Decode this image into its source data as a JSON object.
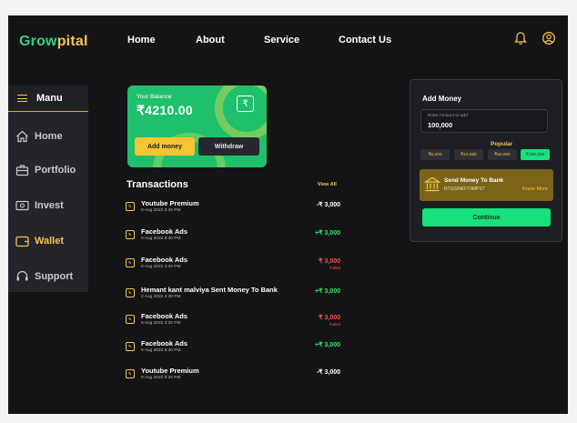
{
  "brand": {
    "part1": "Grow",
    "part2": "pital"
  },
  "nav": [
    "Home",
    "About",
    "Service",
    "Contact Us"
  ],
  "sidebar": {
    "title": "Manu",
    "items": [
      {
        "label": "Home",
        "icon": "home-icon"
      },
      {
        "label": "Portfolio",
        "icon": "briefcase-icon"
      },
      {
        "label": "Invest",
        "icon": "cash-icon"
      },
      {
        "label": "Wallet",
        "icon": "wallet-icon",
        "active": true
      },
      {
        "label": "Support",
        "icon": "headset-icon"
      }
    ]
  },
  "balance": {
    "label": "Your Balance",
    "amount": "₹4210.00",
    "wallet_symbol": "₹",
    "add_label": "Add money",
    "withdraw_label": "Withdraw"
  },
  "transactions": {
    "title": "Transactions",
    "view_all": "View All",
    "items": [
      {
        "name": "Youtube Premium",
        "date": "9 Aug 2022 8:30 PM",
        "amount": "-₹ 3,000",
        "status": "debit"
      },
      {
        "name": "Facebook Ads",
        "date": "9 Aug 2022 8:30 PM",
        "amount": "+₹ 3,000",
        "status": "credit"
      },
      {
        "name": "Facebook Ads",
        "date": "6 Aug 2022 3:30 PM",
        "amount": "₹ 3,000",
        "status": "failed",
        "failed_label": "Failed"
      },
      {
        "name": "Hemant kant malviya Sent Money To Bank",
        "date": "2 Aug 2022 4:30 PM",
        "amount": "+₹ 3,000",
        "status": "credit"
      },
      {
        "name": "Facebook Ads",
        "date": "6 Aug 2022 3:30 PM",
        "amount": "₹ 3,000",
        "status": "failed",
        "failed_label": "Failed"
      },
      {
        "name": "Facebook Ads",
        "date": "9 Aug 2022 8:30 PM",
        "amount": "+₹ 3,000",
        "status": "credit"
      },
      {
        "name": "Youtube Premium",
        "date": "9 Aug 2022 8:30 PM",
        "amount": "-₹ 3,000",
        "status": "debit"
      }
    ]
  },
  "add_money": {
    "title": "Add Money",
    "input_placeholder": "Enter Amount to add",
    "input_value": "100,000",
    "popular_label": "Popular",
    "chips": [
      "₹5,000",
      "₹10,000",
      "₹50,000",
      "₹100,000"
    ],
    "selected_chip": 3,
    "send_title": "Send Money To Bank",
    "send_sub": "RTGS/NEFT/IMPS?",
    "know_more": "Know More",
    "continue_label": "Continue"
  },
  "colors": {
    "background": "#151517",
    "accent_yellow": "#f3c64b",
    "accent_green": "#17e07d",
    "credit": "#2ee86f",
    "failed": "#ff4d4d",
    "debit": "#ffffff"
  }
}
